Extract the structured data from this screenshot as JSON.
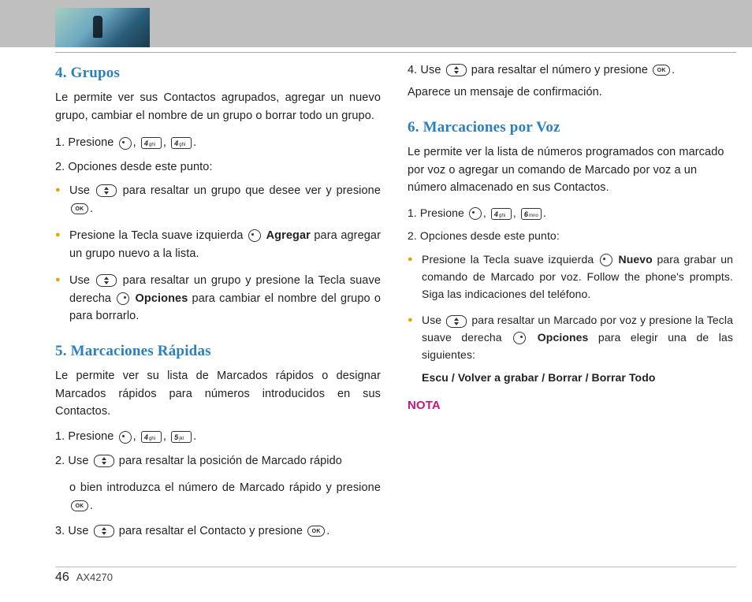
{
  "footer": {
    "page": "46",
    "model": "AX4270"
  },
  "keys": {
    "ok": "OK",
    "k4": {
      "d": "4",
      "l": "ghi"
    },
    "k5": {
      "d": "5",
      "l": "jkl"
    },
    "k6": {
      "d": "6",
      "l": "mno"
    }
  },
  "s4": {
    "title": "4. Grupos",
    "intro": "Le permite ver sus Contactos agrupados, agregar un nuevo grupo, cambiar el nombre de un grupo o borrar todo un grupo.",
    "step1_a": "1.  Presione ",
    "comma": ", ",
    "period": ".",
    "step2": "2.  Opciones desde este punto:",
    "b1_a": "Use ",
    "b1_b": " para resaltar un grupo que desee ver y presione ",
    "b2_a": "Presione la Tecla suave izquierda ",
    "b2_bold": "Agregar",
    "b2_b": " para agregar un grupo nuevo a la lista.",
    "b3_a": "Use ",
    "b3_b": " para resaltar un grupo y presione la Tecla suave derecha ",
    "b3_bold": "Opciones",
    "b3_c": " para cambiar el nombre del grupo o para borrarlo."
  },
  "s5": {
    "title": "5. Marcaciones Rápidas",
    "intro": "Le permite ver su lista de Marcados rápidos o designar Marcados rápidos para números introducidos en sus Contactos.",
    "step1_a": "1.  Presione ",
    "step2_a": "2.  Use ",
    "step2_b": " para resaltar la posición de Marcado rápido",
    "cont_a": "o bien introduzca el número de Marcado rápido y presione ",
    "step3_a": "3.  Use ",
    "step3_b": " para resaltar el Contacto y presione ",
    "step4_a": "4.  Use ",
    "step4_b": " para resaltar el número y presione ",
    "step4_c": "Aparece un mensaje de confirmación."
  },
  "s6": {
    "title": "6. Marcaciones por Voz",
    "intro": "Le permite ver la lista de números programados con marcado por voz o agregar un comando de Marcado por voz a un número almacenado en sus Contactos.",
    "step1_a": "1.   Presione ",
    "step2": "2.   Opciones desde este punto:",
    "b1_a": "Presione la Tecla suave izquierda ",
    "b1_bold": "Nuevo",
    "b1_b": " para grabar un comando de Marcado por voz. Follow the phone's prompts. Siga las indicaciones del teléfono.",
    "b2_a": "Use ",
    "b2_b": " para resaltar un Marcado por voz y presione la Tecla suave derecha ",
    "b2_bold": "Opciones",
    "b2_c": " para elegir una de las siguientes:",
    "options": "Escu / Volver a grabar / Borrar / Borrar Todo",
    "nota": "NOTA"
  }
}
